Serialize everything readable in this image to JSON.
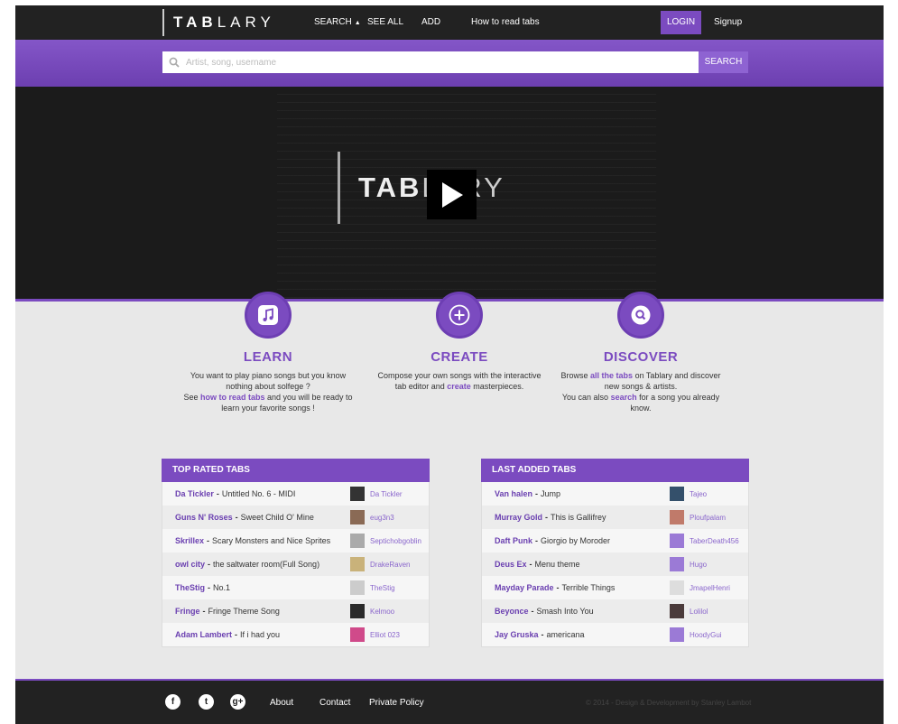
{
  "brand": {
    "logo_bold": "TAB",
    "logo_light": "LARY"
  },
  "nav": {
    "search_label": "SEARCH",
    "see_all_label": "SEE ALL",
    "add_label": "ADD",
    "how_to_label": "How to read tabs",
    "login_label": "LOGIN",
    "signup_label": "Signup"
  },
  "search": {
    "placeholder": "Artist, song, username",
    "button_label": "SEARCH"
  },
  "hero": {
    "logo_bold": "TAB",
    "logo_light": "LARY"
  },
  "features": {
    "learn": {
      "title": "LEARN",
      "line1": "You want to play piano songs but you know nothing about solfege ?",
      "see": "See ",
      "link": "how to read tabs",
      "line2": " and you will be ready to learn your favorite songs !"
    },
    "create": {
      "title": "CREATE",
      "line1": "Compose your own songs with the interactive tab editor and ",
      "link": "create",
      "line2": " masterpieces."
    },
    "discover": {
      "title": "DISCOVER",
      "pre": "Browse ",
      "link1": "all the tabs",
      "mid": " on Tablary and discover new songs & artists.",
      "pre2": "You can also ",
      "link2": "search",
      "post": " for a song you already know."
    }
  },
  "top_rated": {
    "header": "TOP RATED TABS",
    "rows": [
      {
        "artist": "Da Tickler",
        "song": "Untitled No. 6 - MIDI",
        "user": "Da Tickler"
      },
      {
        "artist": "Guns N' Roses",
        "song": "Sweet Child O' Mine",
        "user": "eug3n3"
      },
      {
        "artist": "Skrillex",
        "song": "Scary Monsters and Nice Sprites",
        "user": "Septichobgoblin"
      },
      {
        "artist": "owl city",
        "song": "the saltwater room(Full Song)",
        "user": "DrakeRaven"
      },
      {
        "artist": "TheStig",
        "song": "No.1",
        "user": "TheStig"
      },
      {
        "artist": "Fringe",
        "song": "Fringe Theme Song",
        "user": "Kelmoo"
      },
      {
        "artist": "Adam Lambert",
        "song": "If i had you",
        "user": "Elliot 023"
      }
    ]
  },
  "last_added": {
    "header": "LAST ADDED TABS",
    "rows": [
      {
        "artist": "Van halen",
        "song": "Jump",
        "user": "Tajeo"
      },
      {
        "artist": "Murray Gold",
        "song": "This is Gallifrey",
        "user": "Ploufpalam"
      },
      {
        "artist": "Daft Punk",
        "song": "Giorgio by Moroder",
        "user": "TaberDeath456"
      },
      {
        "artist": "Deus Ex",
        "song": "Menu theme",
        "user": "Hugo"
      },
      {
        "artist": "Mayday Parade",
        "song": "Terrible Things",
        "user": "JmapelHenri"
      },
      {
        "artist": "Beyonce",
        "song": "Smash Into You",
        "user": "Lolilol"
      },
      {
        "artist": "Jay Gruska",
        "song": "americana",
        "user": "HoodyGui"
      }
    ]
  },
  "footer": {
    "about": "About",
    "contact": "Contact",
    "private_policy": "Private Policy",
    "copyright": "© 2014 - Design & Development by Stanley Lambot"
  },
  "icons": {
    "learn": "music-note-icon",
    "create": "plus-icon",
    "discover": "search-icon",
    "social": [
      "facebook-icon",
      "twitter-icon",
      "google-plus-icon"
    ]
  },
  "colors": {
    "accent": "#7b4bc0",
    "dark": "#222222"
  }
}
